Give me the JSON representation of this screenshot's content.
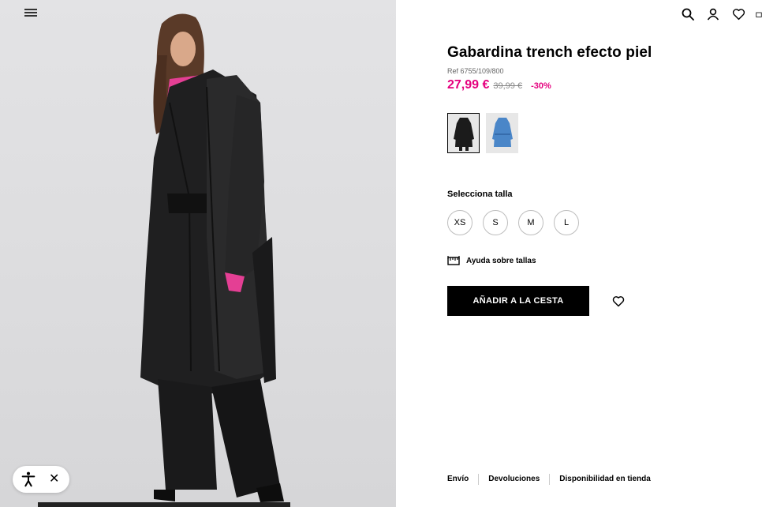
{
  "header": {
    "menu_icon": "hamburger-icon",
    "icons": [
      "search-icon",
      "user-icon",
      "heart-icon",
      "bag-icon"
    ]
  },
  "product": {
    "title": "Gabardina trench efecto piel",
    "ref": "Ref 6755/109/800",
    "price_now": "27,99 €",
    "price_old": "39,99 €",
    "discount": "-30%",
    "colors": [
      {
        "name": "black",
        "hex": "#1b1b1b",
        "selected": true
      },
      {
        "name": "blue",
        "hex": "#4a86c8",
        "selected": false
      }
    ]
  },
  "size_section": {
    "label": "Selecciona talla",
    "sizes": [
      "XS",
      "S",
      "M",
      "L"
    ],
    "help_label": "Ayuda sobre tallas"
  },
  "actions": {
    "add_to_cart": "AÑADIR A LA CESTA"
  },
  "footer": {
    "links": [
      "Envío",
      "Devoluciones",
      "Disponibilidad en tienda"
    ]
  },
  "accessibility": {
    "icon": "accessibility-icon",
    "close": "✕"
  },
  "colors": {
    "accent": "#e5007e",
    "button": "#000000",
    "image_bg": "#dcdcde"
  }
}
